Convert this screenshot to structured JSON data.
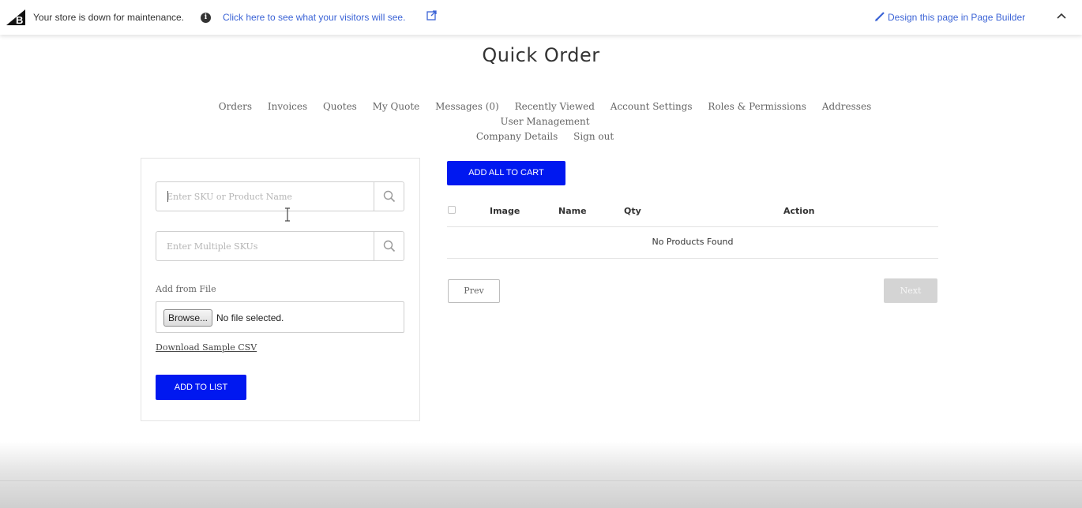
{
  "maintenance_bar": {
    "message": "Your store is down for maintenance.",
    "preview_link": "Click here to see what your visitors will see.",
    "page_builder_link": "Design this page in Page Builder",
    "colors": {
      "link": "#3c64d6",
      "text": "#333333"
    },
    "icons": [
      "bigcommerce-logo-icon",
      "info-icon",
      "external-link-icon",
      "pencil-icon",
      "chevron-up-icon"
    ]
  },
  "page": {
    "title": "Quick Order"
  },
  "account_nav": {
    "items": [
      "Orders",
      "Invoices",
      "Quotes",
      "My Quote",
      "Messages (0)",
      "Recently Viewed",
      "Account Settings",
      "Roles & Permissions",
      "Addresses",
      "User Management",
      "Company Details",
      "Sign out"
    ]
  },
  "left_panel": {
    "sku_search_placeholder": "Enter SKU or Product Name",
    "multi_sku_placeholder": "Enter Multiple SKUs",
    "file_label": "Add from File",
    "browse_label": "Browse...",
    "no_file_text": "No file selected.",
    "download_csv": "Download Sample CSV",
    "add_to_list": "ADD TO LIST"
  },
  "product_table": {
    "add_all_to_cart": "ADD ALL TO CART",
    "columns": {
      "image": "Image",
      "name": "Name",
      "qty": "Qty",
      "action": "Action"
    },
    "empty_message": "No Products Found",
    "pagination": {
      "prev": "Prev",
      "next": "Next"
    }
  },
  "colors": {
    "primary_button": "#0018f0",
    "disabled_button": "#d4d4d4"
  }
}
